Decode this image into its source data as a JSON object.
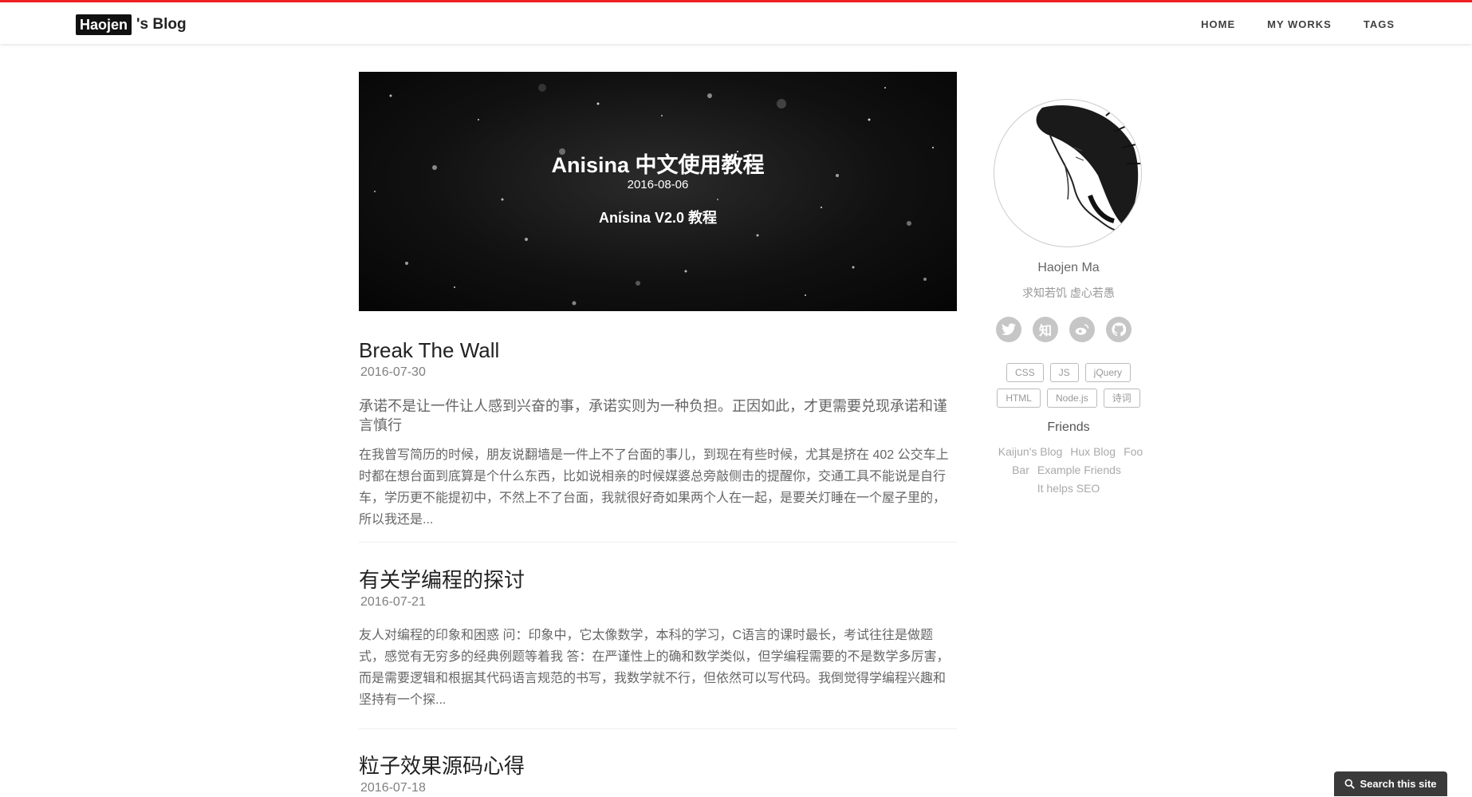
{
  "brand": {
    "box": "Haojen",
    "rest": "'s Blog"
  },
  "nav": [
    {
      "label": "HOME"
    },
    {
      "label": "MY WORKS"
    },
    {
      "label": "TAGS"
    }
  ],
  "hero": {
    "title": "Anisina 中文使用教程",
    "date": "2016-08-06",
    "subtitle": "Anisina V2.0 教程"
  },
  "posts": [
    {
      "title": "Break The Wall",
      "date": "2016-07-30",
      "subtitle": "承诺不是让一件让人感到兴奋的事，承诺实则为一种负担。正因如此，才更需要兑现承诺和谨言慎行",
      "excerpt": "在我曾写简历的时候，朋友说翻墙是一件上不了台面的事儿，到现在有些时候，尤其是挤在 402 公交车上时都在想台面到底算是个什么东西，比如说相亲的时候媒婆总旁敲侧击的提醒你，交通工具不能说是自行车，学历更不能提初中，不然上不了台面，我就很好奇如果两个人在一起，是要关灯睡在一个屋子里的，所以我还是..."
    },
    {
      "title": "有关学编程的探讨",
      "date": "2016-07-21",
      "excerpt": "友人对编程的印象和困惑 问：印象中，它太像数学，本科的学习，C语言的课时最长，考试往往是做题式，感觉有无穷多的经典例题等着我 答：在严谨性上的确和数学类似，但学编程需要的不是数学多厉害，而是需要逻辑和根据其代码语言规范的书写，我数学就不行，但依然可以写代码。我倒觉得学编程兴趣和坚持有一个探..."
    },
    {
      "title": "粒子效果源码心得",
      "date": "2016-07-18"
    }
  ],
  "sidebar": {
    "author": "Haojen Ma",
    "motto": "求知若饥 虚心若愚",
    "socials": [
      {
        "icon": "twitter-icon"
      },
      {
        "icon": "zhihu-icon",
        "glyph": "知"
      },
      {
        "icon": "weibo-icon"
      },
      {
        "icon": "github-icon"
      }
    ],
    "tags": [
      [
        "CSS",
        "JS",
        "jQuery"
      ],
      [
        "HTML",
        "Node.js",
        "诗词"
      ]
    ],
    "friends_title": "Friends",
    "friends": [
      "Kaijun's Blog",
      "Hux Blog",
      "Foo Bar",
      "Example Friends",
      "It helps SEO"
    ]
  },
  "search": {
    "label": "Search this site"
  },
  "colors": {
    "accent": "#ee2222",
    "text": "#404040",
    "muted": "#999999"
  }
}
